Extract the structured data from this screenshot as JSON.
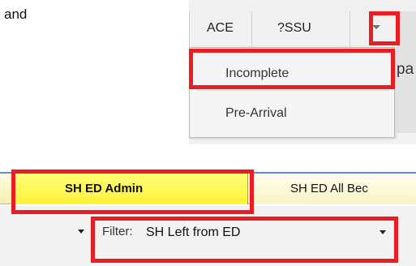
{
  "intro_text": "and",
  "top_tabs": {
    "tab1_label": "ACE",
    "tab2_label": "?SSU",
    "partial_text": "pa"
  },
  "dropdown": {
    "items": [
      "Incomplete",
      "Pre-Arrival"
    ]
  },
  "ed_tabs": {
    "active_label": "SH ED Admin",
    "other_label": "SH ED All Bec"
  },
  "filter": {
    "label": "Filter:",
    "value": "SH Left from ED"
  },
  "colors": {
    "highlight": "#ea1c24",
    "active_tab": "#fff13a"
  }
}
